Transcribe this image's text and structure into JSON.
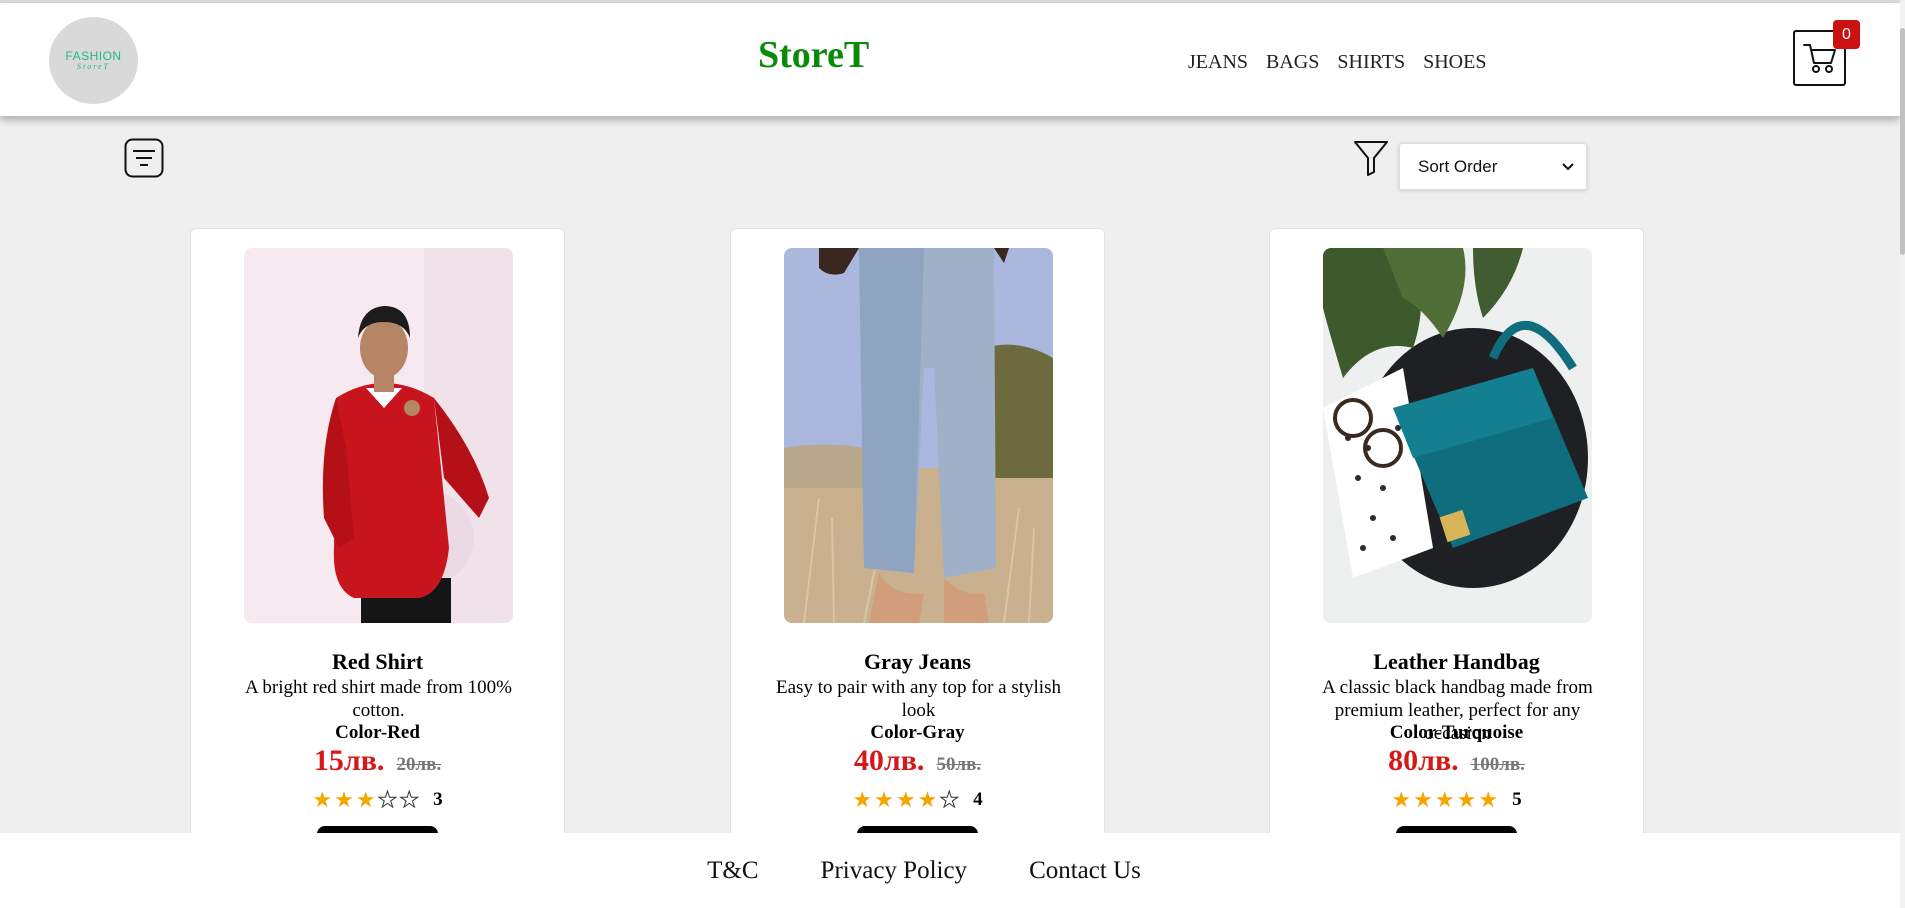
{
  "header": {
    "logo_line1": "FASHION",
    "logo_line2": "StoreT",
    "brand": "StoreT",
    "nav": [
      "JEANS",
      "BAGS",
      "SHIRTS",
      "SHOES"
    ],
    "cart_count": "0"
  },
  "toolbar": {
    "sort_select": "Sort Order"
  },
  "products": [
    {
      "name": "Red Shirt",
      "description": "A bright red shirt made from 100% cotton.",
      "color": "Color-Red",
      "price": "15лв.",
      "old_price": "20лв.",
      "rating": 3,
      "rating_text": "3"
    },
    {
      "name": "Gray Jeans",
      "description": "Easy to pair with any top for a stylish look",
      "color": "Color-Gray",
      "price": "40лв.",
      "old_price": "50лв.",
      "rating": 4,
      "rating_text": "4"
    },
    {
      "name": "Leather Handbag",
      "description": "A classic black handbag made from premium leather, perfect for any occasion",
      "color": "Color-Turquoise",
      "price": "80лв.",
      "old_price": "100лв.",
      "rating": 5,
      "rating_text": "5"
    }
  ],
  "footer": {
    "links": [
      "T&C",
      "Privacy Policy",
      "Contact Us"
    ]
  },
  "colors": {
    "brand": "#0a8a0a",
    "price": "#d61818",
    "star": "#f5a500",
    "badge": "#cc1111"
  }
}
